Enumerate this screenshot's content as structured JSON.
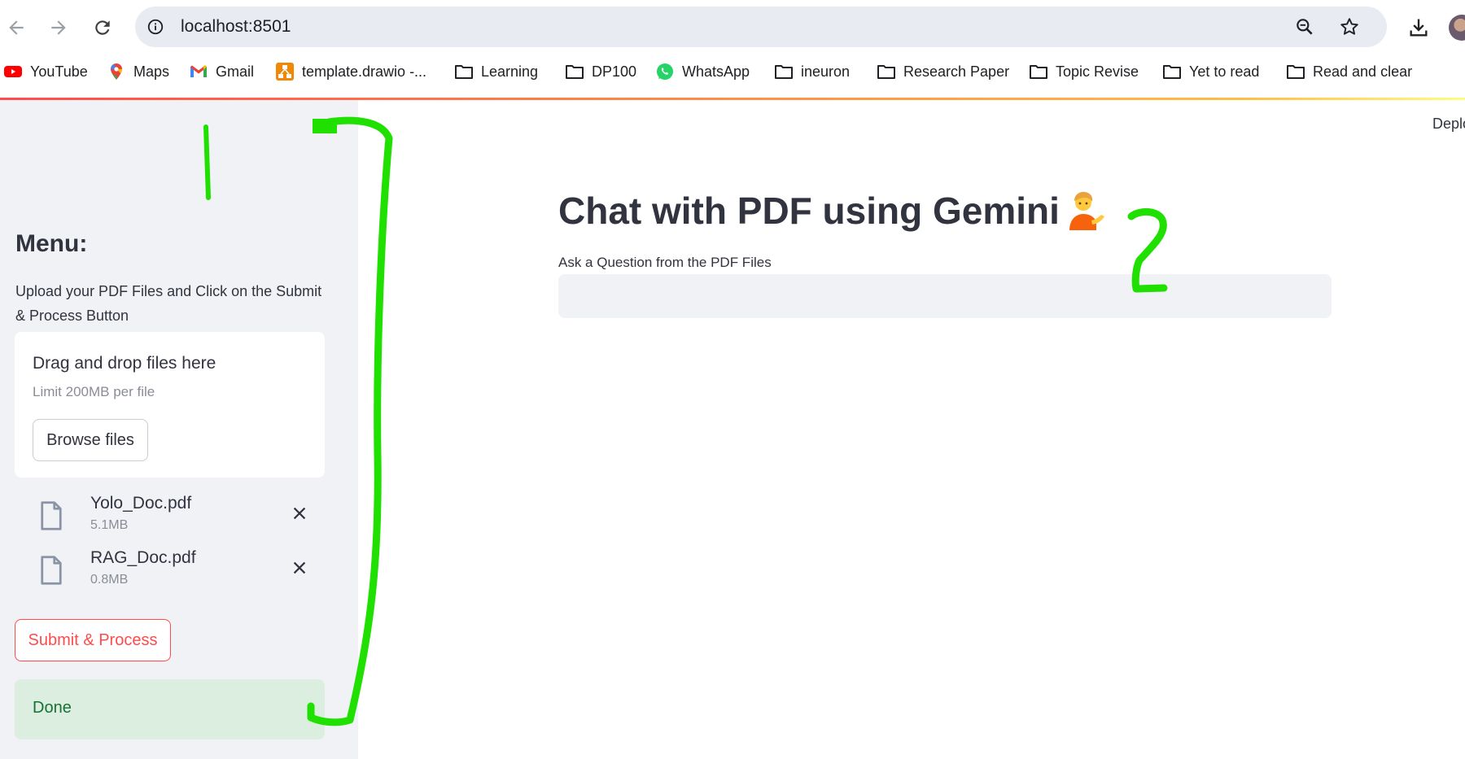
{
  "browser": {
    "url": "localhost:8501",
    "bookmarks": [
      {
        "label": "YouTube",
        "icon": "youtube-icon"
      },
      {
        "label": "Maps",
        "icon": "maps-pin-icon"
      },
      {
        "label": "Gmail",
        "icon": "gmail-icon"
      },
      {
        "label": "template.drawio -...",
        "icon": "drawio-icon"
      },
      {
        "label": "Learning",
        "icon": "folder-icon"
      },
      {
        "label": "DP100",
        "icon": "folder-icon"
      },
      {
        "label": "WhatsApp",
        "icon": "whatsapp-icon"
      },
      {
        "label": "ineuron",
        "icon": "folder-icon"
      },
      {
        "label": "Research Paper",
        "icon": "folder-icon"
      },
      {
        "label": "Topic Revise",
        "icon": "folder-icon"
      },
      {
        "label": "Yet to read",
        "icon": "folder-icon"
      },
      {
        "label": "Read and clear",
        "icon": "folder-icon"
      }
    ]
  },
  "sidebar": {
    "close": "✕",
    "title": "Menu:",
    "description": "Upload your PDF Files and Click on the Submit & Process Button",
    "uploader": {
      "drop_text": "Drag and drop files here",
      "limit_text": "Limit 200MB per file",
      "browse_label": "Browse files"
    },
    "files": [
      {
        "name": "Yolo_Doc.pdf",
        "size": "5.1MB"
      },
      {
        "name": "RAG_Doc.pdf",
        "size": "0.8MB"
      }
    ],
    "submit_label": "Submit & Process",
    "status_text": "Done"
  },
  "main": {
    "deploy_label": "Deploy",
    "title": "Chat with PDF using Gemini",
    "question_label": "Ask a Question from the PDF Files",
    "question_value": ""
  },
  "annotations": {
    "marks": [
      "1",
      "2"
    ],
    "color": "#1fe000"
  },
  "colors": {
    "accent": "#ff4b4b",
    "sidebar_bg": "#f0f2f6",
    "success_bg": "#dbeedf",
    "success_text": "#177233"
  }
}
